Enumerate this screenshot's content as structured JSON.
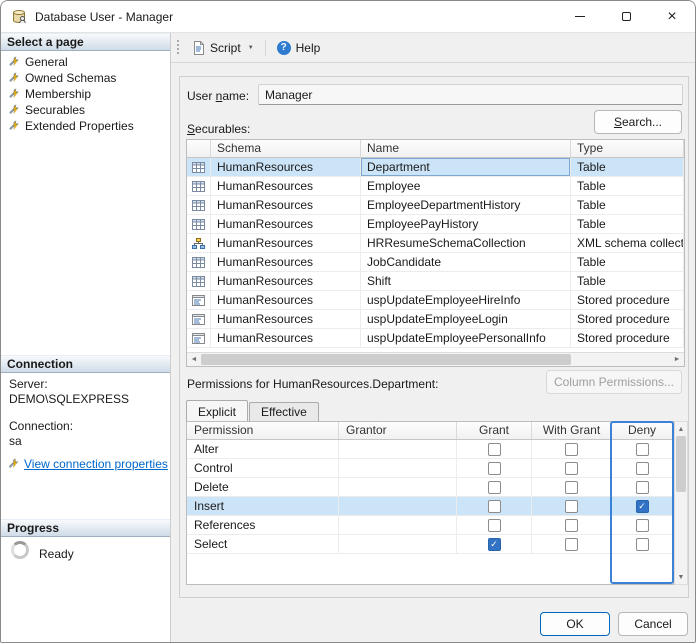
{
  "window": {
    "title": "Database User - Manager"
  },
  "icons": {
    "close": "×",
    "dropdown": "▼",
    "help": "?",
    "check": "✓",
    "up": "▲",
    "down": "▼",
    "left": "◄",
    "right": "►"
  },
  "colors": {
    "selection": "#cce4f7",
    "checkbox_checked": "#3273c5",
    "deny_highlight": "#3b82d6",
    "link": "#0066cc"
  },
  "sidebar": {
    "select_page": {
      "header": "Select a page",
      "items": [
        {
          "label": "General"
        },
        {
          "label": "Owned Schemas"
        },
        {
          "label": "Membership"
        },
        {
          "label": "Securables"
        },
        {
          "label": "Extended Properties"
        }
      ]
    },
    "connection": {
      "header": "Connection",
      "server_label": "Server:",
      "server_value": "DEMO\\SQLEXPRESS",
      "connection_label": "Connection:",
      "connection_value": "sa",
      "view_link": "View connection properties"
    },
    "progress": {
      "header": "Progress",
      "status": "Ready"
    }
  },
  "toolbar": {
    "script": "Script",
    "help": "Help"
  },
  "main": {
    "user_name": {
      "pre": "User ",
      "key": "n",
      "post": "ame:",
      "value": "Manager"
    },
    "securables_label": {
      "pre": "",
      "key": "S",
      "post": "ecurables:"
    },
    "search_button": {
      "pre": "",
      "key": "S",
      "post": "earch..."
    },
    "securables": {
      "columns": {
        "schema": "Schema",
        "name": "Name",
        "type": "Type"
      },
      "rows": [
        {
          "icon": "table-icon",
          "schema": "HumanResources",
          "name": "Department",
          "type": "Table",
          "selected": true
        },
        {
          "icon": "table-icon",
          "schema": "HumanResources",
          "name": "Employee",
          "type": "Table",
          "selected": false
        },
        {
          "icon": "table-icon",
          "schema": "HumanResources",
          "name": "EmployeeDepartmentHistory",
          "type": "Table",
          "selected": false
        },
        {
          "icon": "table-icon",
          "schema": "HumanResources",
          "name": "EmployeePayHistory",
          "type": "Table",
          "selected": false
        },
        {
          "icon": "xml-schema-collection-icon",
          "schema": "HumanResources",
          "name": "HRResumeSchemaCollection",
          "type": "XML schema collection",
          "selected": false
        },
        {
          "icon": "table-icon",
          "schema": "HumanResources",
          "name": "JobCandidate",
          "type": "Table",
          "selected": false
        },
        {
          "icon": "table-icon",
          "schema": "HumanResources",
          "name": "Shift",
          "type": "Table",
          "selected": false
        },
        {
          "icon": "stored-procedure-icon",
          "schema": "HumanResources",
          "name": "uspUpdateEmployeeHireInfo",
          "type": "Stored procedure",
          "selected": false
        },
        {
          "icon": "stored-procedure-icon",
          "schema": "HumanResources",
          "name": "uspUpdateEmployeeLogin",
          "type": "Stored procedure",
          "selected": false
        },
        {
          "icon": "stored-procedure-icon",
          "schema": "HumanResources",
          "name": "uspUpdateEmployeePersonalInfo",
          "type": "Stored procedure",
          "selected": false
        }
      ]
    },
    "permissions": {
      "label": "Permissions for HumanResources.Department:",
      "column_permissions_button": "Column Permissions...",
      "tabs": [
        {
          "label": "Explicit",
          "active": true
        },
        {
          "label": "Effective",
          "active": false
        }
      ],
      "columns": {
        "permission": "Permission",
        "grantor": "Grantor",
        "grant": "Grant",
        "with_grant": "With Grant",
        "deny": "Deny"
      },
      "rows": [
        {
          "permission": "Alter",
          "grantor": "",
          "grant": false,
          "with_grant": false,
          "deny": false,
          "selected": false
        },
        {
          "permission": "Control",
          "grantor": "",
          "grant": false,
          "with_grant": false,
          "deny": false,
          "selected": false
        },
        {
          "permission": "Delete",
          "grantor": "",
          "grant": false,
          "with_grant": false,
          "deny": false,
          "selected": false
        },
        {
          "permission": "Insert",
          "grantor": "",
          "grant": false,
          "with_grant": false,
          "deny": true,
          "selected": true
        },
        {
          "permission": "References",
          "grantor": "",
          "grant": false,
          "with_grant": false,
          "deny": false,
          "selected": false
        },
        {
          "permission": "Select",
          "grantor": "",
          "grant": true,
          "with_grant": false,
          "deny": false,
          "selected": false
        }
      ]
    }
  },
  "footer": {
    "ok": "OK",
    "cancel": "Cancel"
  }
}
